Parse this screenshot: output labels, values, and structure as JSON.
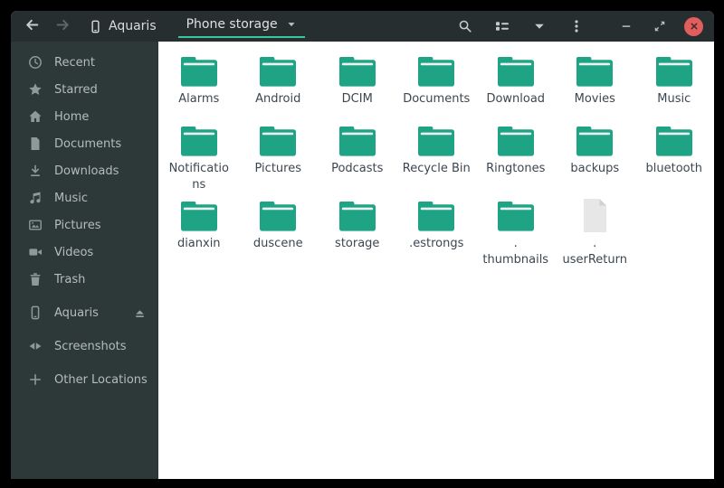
{
  "colors": {
    "titlebar_bg": "#262e30",
    "sidebar_bg": "#2d3839",
    "content_bg": "#ffffff",
    "accent_teal": "#35c7a0",
    "folder": "#1ea385",
    "folder_stripe": "#edf2f0",
    "file_icon": "#e7e7e7",
    "close_button": "#e05e5e"
  },
  "titlebar": {
    "back_icon": "arrow-left-icon",
    "forward_icon": "arrow-right-icon",
    "device_button": {
      "icon": "phone-icon",
      "label": "Aquaris"
    },
    "location_tab": {
      "label": "Phone storage",
      "caret_icon": "caret-down-icon",
      "active": true
    },
    "actions": [
      "search-icon",
      "list-view-icon",
      "caret-down-icon",
      "menu-kebab-icon"
    ],
    "window_controls": [
      "minimize",
      "restore",
      "close"
    ]
  },
  "sidebar": {
    "items": [
      {
        "label": "Recent",
        "icon": "recent-icon"
      },
      {
        "label": "Starred",
        "icon": "star-icon"
      },
      {
        "label": "Home",
        "icon": "home-icon"
      },
      {
        "label": "Documents",
        "icon": "document-icon"
      },
      {
        "label": "Downloads",
        "icon": "download-icon"
      },
      {
        "label": "Music",
        "icon": "music-icon"
      },
      {
        "label": "Pictures",
        "icon": "picture-icon"
      },
      {
        "label": "Videos",
        "icon": "video-icon"
      },
      {
        "label": "Trash",
        "icon": "trash-icon"
      },
      {
        "label": "Aquaris",
        "icon": "phone-icon",
        "trailing_icon": "eject-icon",
        "group": "devices"
      },
      {
        "label": "Screenshots",
        "icon": "removable-media-icon",
        "group": "devices"
      },
      {
        "label": "Other Locations",
        "icon": "plus-icon",
        "group": "devices"
      }
    ]
  },
  "files": {
    "items": [
      {
        "name": "Alarms",
        "kind": "folder"
      },
      {
        "name": "Android",
        "kind": "folder"
      },
      {
        "name": "DCIM",
        "kind": "folder"
      },
      {
        "name": "Documents",
        "kind": "folder"
      },
      {
        "name": "Download",
        "kind": "folder"
      },
      {
        "name": "Movies",
        "kind": "folder"
      },
      {
        "name": "Music",
        "kind": "folder"
      },
      {
        "name": "Notifications",
        "kind": "folder",
        "display": "Notificatio\nns"
      },
      {
        "name": "Pictures",
        "kind": "folder"
      },
      {
        "name": "Podcasts",
        "kind": "folder"
      },
      {
        "name": "Recycle Bin",
        "kind": "folder"
      },
      {
        "name": "Ringtones",
        "kind": "folder"
      },
      {
        "name": "backups",
        "kind": "folder"
      },
      {
        "name": "bluetooth",
        "kind": "folder"
      },
      {
        "name": "dianxin",
        "kind": "folder"
      },
      {
        "name": "duscene",
        "kind": "folder"
      },
      {
        "name": "storage",
        "kind": "folder"
      },
      {
        "name": ".estrongs",
        "kind": "folder"
      },
      {
        "name": ".thumbnails",
        "kind": "folder",
        "display": ".\nthumbnails"
      },
      {
        "name": ".userReturn",
        "kind": "file",
        "display": ".\nuserReturn"
      }
    ]
  }
}
